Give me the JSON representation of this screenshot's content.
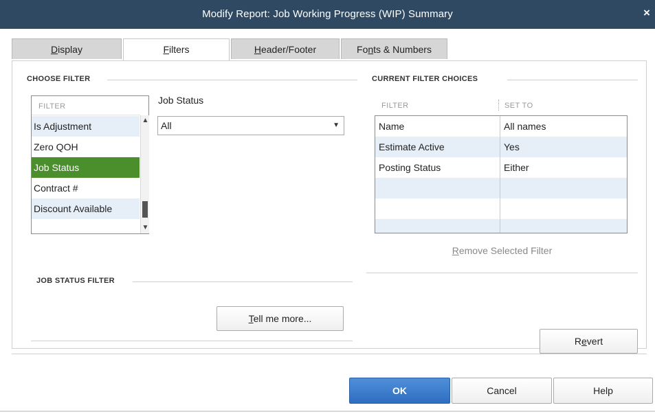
{
  "window": {
    "title": "Modify Report: Job Working Progress (WIP) Summary",
    "close_glyph": "×"
  },
  "tabs": [
    {
      "label_ul": "D",
      "label_rest": "isplay",
      "active": false
    },
    {
      "label_ul": "F",
      "label_rest": "ilters",
      "active": true
    },
    {
      "label_ul": "H",
      "label_rest": "eader/Footer",
      "active": false
    },
    {
      "label_pre": "Fo",
      "label_ul": "n",
      "label_rest": "ts & Numbers",
      "active": false
    }
  ],
  "choose_filter": {
    "title": "CHOOSE FILTER",
    "list_header": "FILTER",
    "items": [
      "Is Adjustment",
      "Zero QOH",
      "Job Status",
      "Contract #",
      "Discount Available"
    ],
    "selected": "Job Status"
  },
  "job_status": {
    "label": "Job Status",
    "value": "All"
  },
  "job_status_filter": {
    "title": "JOB STATUS FILTER"
  },
  "current_filter_choices": {
    "title": "CURRENT FILTER CHOICES",
    "col_filter": "FILTER",
    "col_set_to": "SET TO",
    "rows": [
      {
        "filter": "Name",
        "set_to": "All names"
      },
      {
        "filter": "Estimate Active",
        "set_to": "Yes"
      },
      {
        "filter": "Posting Status",
        "set_to": "Either"
      }
    ]
  },
  "buttons": {
    "remove_filter_ul": "R",
    "remove_filter_rest": "emove Selected Filter",
    "tell_me_ul": "T",
    "tell_me_rest": "ell me more...",
    "revert_pre": "R",
    "revert_ul": "e",
    "revert_rest": "vert",
    "ok": "OK",
    "cancel": "Cancel",
    "help": "Help"
  },
  "colors": {
    "titlebar": "#2f4963",
    "selected_row": "#4a8f2b",
    "ok_button": "#2f6ec0",
    "alt_row": "#e6eef8"
  }
}
